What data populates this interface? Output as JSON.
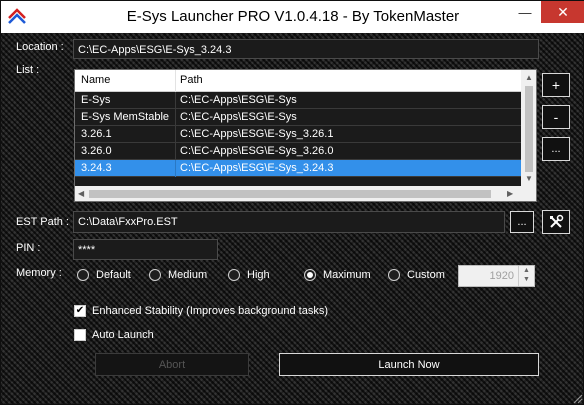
{
  "window": {
    "title": "E-Sys Launcher PRO V1.0.4.18 - By TokenMaster",
    "minimize_glyph": "—",
    "close_glyph": "✕"
  },
  "location": {
    "label": "Location :",
    "value": "C:\\EC-Apps\\ESG\\E-Sys_3.24.3"
  },
  "list": {
    "label": "List :",
    "columns": [
      "Name",
      "Path"
    ],
    "rows": [
      {
        "name": "E-Sys",
        "path": "C:\\EC-Apps\\ESG\\E-Sys"
      },
      {
        "name": "E-Sys MemStable",
        "path": "C:\\EC-Apps\\ESG\\E-Sys"
      },
      {
        "name": "3.26.1",
        "path": "C:\\EC-Apps\\ESG\\E-Sys_3.26.1"
      },
      {
        "name": "3.26.0",
        "path": "C:\\EC-Apps\\ESG\\E-Sys_3.26.0"
      },
      {
        "name": "3.24.3",
        "path": "C:\\EC-Apps\\ESG\\E-Sys_3.24.3"
      }
    ],
    "selected_index": 4,
    "add_label": "+",
    "remove_label": "-",
    "browse_label": "..."
  },
  "est": {
    "label": "EST Path :",
    "value": "C:\\Data\\FxxPro.EST",
    "browse_label": "...",
    "tools_icon": "wrench-screwdriver-icon"
  },
  "pin": {
    "label": "PIN :",
    "value": "****"
  },
  "memory": {
    "label": "Memory :",
    "options": [
      "Default",
      "Medium",
      "High",
      "Maximum",
      "Custom"
    ],
    "selected": "Maximum",
    "custom_value": "1920"
  },
  "enhanced_stability": {
    "label": "Enhanced Stability (Improves background tasks)",
    "checked": true
  },
  "auto_launch": {
    "label": "Auto Launch",
    "checked": false
  },
  "buttons": {
    "abort": "Abort",
    "launch": "Launch Now"
  },
  "colors": {
    "selection": "#3390ea",
    "close_button": "#c7372f"
  }
}
